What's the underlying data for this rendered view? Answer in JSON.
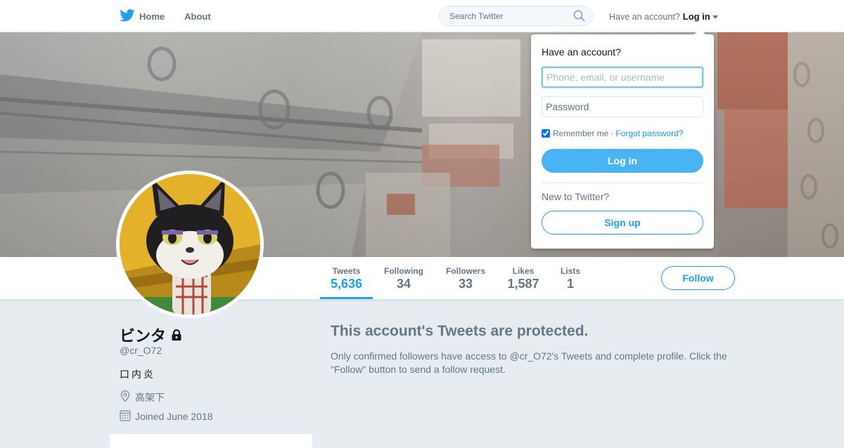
{
  "nav": {
    "home_label": "Home",
    "about_label": "About",
    "search_placeholder": "Search Twitter",
    "have_account_text": "Have an account?",
    "login_toggle_label": "Log in"
  },
  "colors": {
    "accent": "#1da1f2",
    "login_button": "#4ab3f4",
    "page_background": "#e6ecf0"
  },
  "icons": [
    "twitter-bird-icon",
    "search-icon",
    "lock-icon",
    "location-icon",
    "calendar-icon"
  ],
  "profile": {
    "name": "ビンタ",
    "handle": "@cr_O72",
    "bio": "口内炎",
    "location": "高架下",
    "joined": "Joined June 2018",
    "protected": true
  },
  "stats": [
    {
      "label": "Tweets",
      "value": "5,636",
      "active": true
    },
    {
      "label": "Following",
      "value": "34"
    },
    {
      "label": "Followers",
      "value": "33"
    },
    {
      "label": "Likes",
      "value": "1,587"
    },
    {
      "label": "Lists",
      "value": "1"
    }
  ],
  "follow_label": "Follow",
  "protected_message": {
    "title": "This account's Tweets are protected.",
    "body": "Only confirmed followers have access to @cr_O72's Tweets and complete profile. Click the \"Follow\" button to send a follow request."
  },
  "login_dropdown": {
    "title": "Have an account?",
    "username_placeholder": "Phone, email, or username",
    "password_placeholder": "Password",
    "remember_label": "Remember me",
    "separator": "·",
    "remember_checked": true,
    "forgot_label": "Forgot password?",
    "login_label": "Log in",
    "new_text": "New to Twitter?",
    "signup_label": "Sign up"
  }
}
